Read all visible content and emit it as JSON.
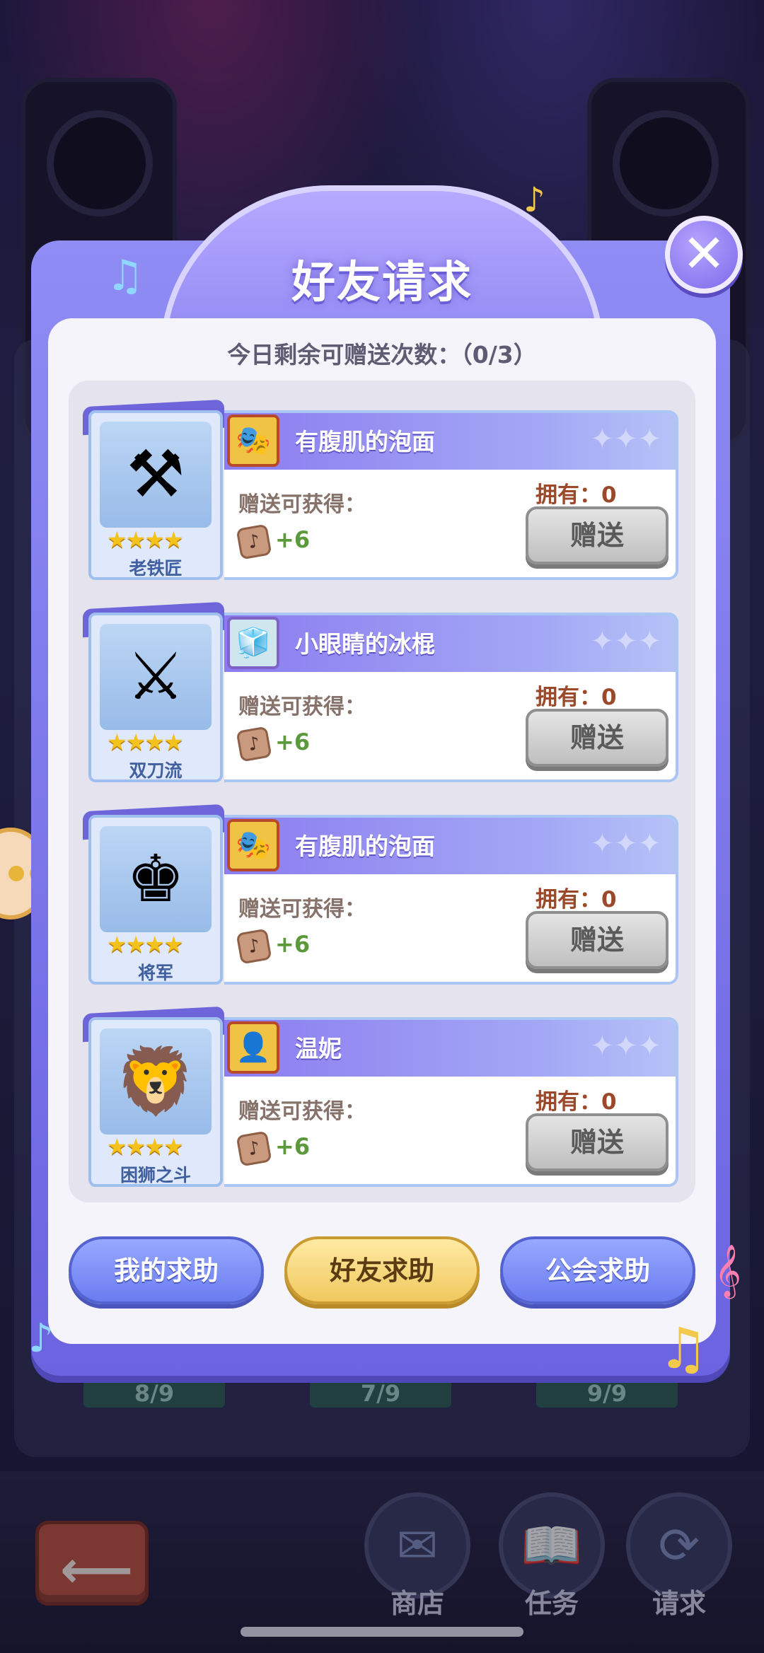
{
  "dialog": {
    "title": "好友请求",
    "close_icon": "close-icon",
    "quota_text": "今日剩余可赠送次数：（0/3）"
  },
  "requests": [
    {
      "skill": "老铁匠",
      "skill_icon": "blacksmith-icon",
      "stars": "★★★★",
      "requester": "有腹肌的泡面",
      "gain_label": "赠送可获得：",
      "reward": "+6",
      "own": "拥有：0",
      "give_label": "赠送"
    },
    {
      "skill": "双刀流",
      "skill_icon": "crossed-swords-icon",
      "stars": "★★★★",
      "requester": "小眼睛的冰棍",
      "gain_label": "赠送可获得：",
      "reward": "+6",
      "own": "拥有：0",
      "give_label": "赠送"
    },
    {
      "skill": "将军",
      "skill_icon": "chess-icon",
      "stars": "★★★★",
      "requester": "有腹肌的泡面",
      "gain_label": "赠送可获得：",
      "reward": "+6",
      "own": "拥有：0",
      "give_label": "赠送"
    },
    {
      "skill": "困狮之斗",
      "skill_icon": "caged-lion-icon",
      "stars": "★★★★",
      "requester": "温妮",
      "gain_label": "赠送可获得：",
      "reward": "+6",
      "own": "拥有：0",
      "give_label": "赠送"
    }
  ],
  "tabs": {
    "my_help": "我的求助",
    "friend_help": "好友求助",
    "guild_help": "公会求助",
    "active": "friend_help"
  },
  "background": {
    "progress": [
      "8/9",
      "7/9",
      "9/9"
    ],
    "nav": [
      {
        "label": "商店",
        "icon": "mailbox-icon"
      },
      {
        "label": "任务",
        "icon": "task-book-icon"
      },
      {
        "label": "请求",
        "icon": "request-stamp-icon"
      }
    ]
  },
  "colors": {
    "dialog_purple": "#8f8cf4",
    "give_button_gray": "#cfcfcf",
    "active_tab_gold": "#f0c85e",
    "tab_blue": "#7f90f5"
  }
}
